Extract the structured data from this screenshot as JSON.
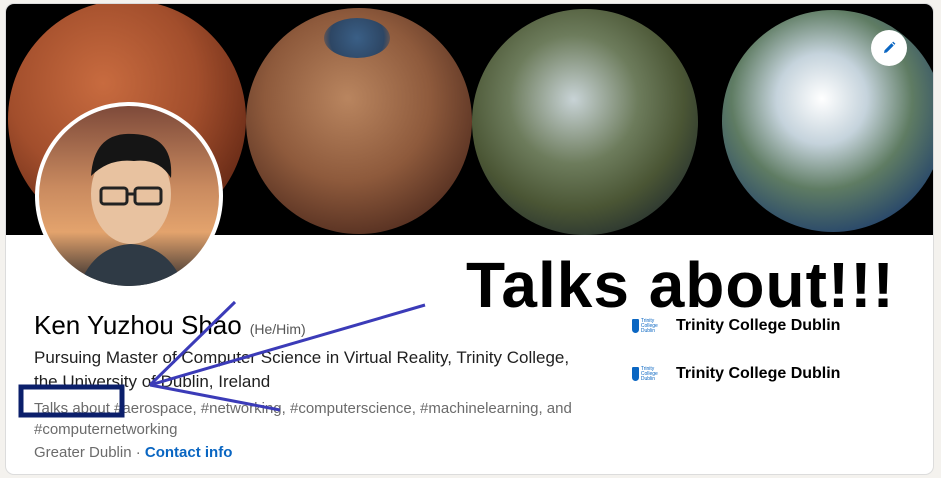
{
  "profile": {
    "name": "Ken Yuzhou Shao",
    "pronouns": "(He/Him)",
    "headline": "Pursuing Master of Computer Science in Virtual Reality, Trinity College, the University of Dublin, Ireland",
    "talks_about": "Talks about #aerospace, #networking, #computerscience, #machinelearning, and #computernetworking",
    "location": "Greater Dublin",
    "separator": " · ",
    "contact_label": "Contact info"
  },
  "education": [
    {
      "name": "Trinity College Dublin",
      "logo_text": "Trinity College Dublin"
    },
    {
      "name": "Trinity College Dublin",
      "logo_text": "Trinity College Dublin"
    }
  ],
  "annotation": {
    "title": "Talks about!!!"
  },
  "icons": {
    "edit": "pencil-icon"
  },
  "colors": {
    "link": "#0a66c2",
    "annotation_stroke": "#3b3bb8",
    "highlight_box": "#0b1f6b"
  }
}
